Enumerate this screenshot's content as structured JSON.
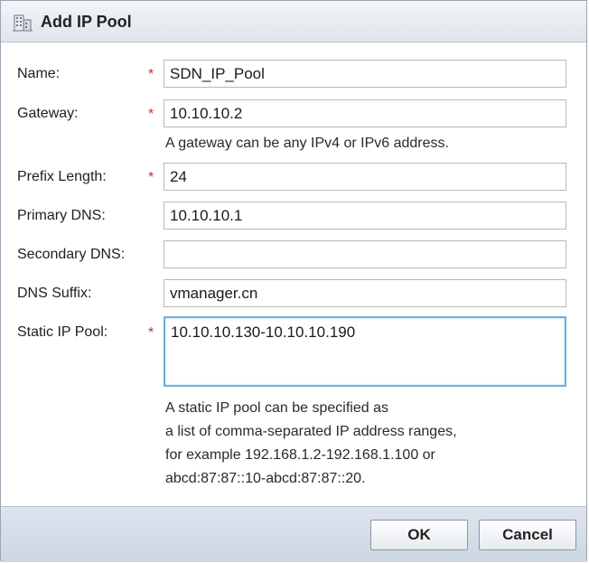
{
  "dialog": {
    "title": "Add IP Pool",
    "title_icon": "building-icon"
  },
  "form": {
    "required_mark": "*",
    "name": {
      "label": "Name:",
      "value": "SDN_IP_Pool",
      "required": true
    },
    "gateway": {
      "label": "Gateway:",
      "value": "10.10.10.2",
      "required": true,
      "hint": "A gateway can be any IPv4 or IPv6 address."
    },
    "prefix_length": {
      "label": "Prefix Length:",
      "value": "24",
      "required": true
    },
    "primary_dns": {
      "label": "Primary DNS:",
      "value": "10.10.10.1"
    },
    "secondary_dns": {
      "label": "Secondary DNS:",
      "value": ""
    },
    "dns_suffix": {
      "label": "DNS Suffix:",
      "value": "vmanager.cn"
    },
    "static_ip_pool": {
      "label": "Static IP Pool:",
      "value": "10.10.10.130-10.10.10.190",
      "required": true,
      "hint_lines": [
        "A static IP pool can be specified as",
        "a list of comma-separated IP address ranges,",
        "for example 192.168.1.2-192.168.1.100 or",
        "abcd:87:87::10-abcd:87:87::20."
      ]
    }
  },
  "buttons": {
    "ok_label": "OK",
    "cancel_label": "Cancel"
  },
  "colors": {
    "required": "#c0392b",
    "focus_border": "#6fb0d6",
    "footer_bg": "#d3dbe6"
  }
}
